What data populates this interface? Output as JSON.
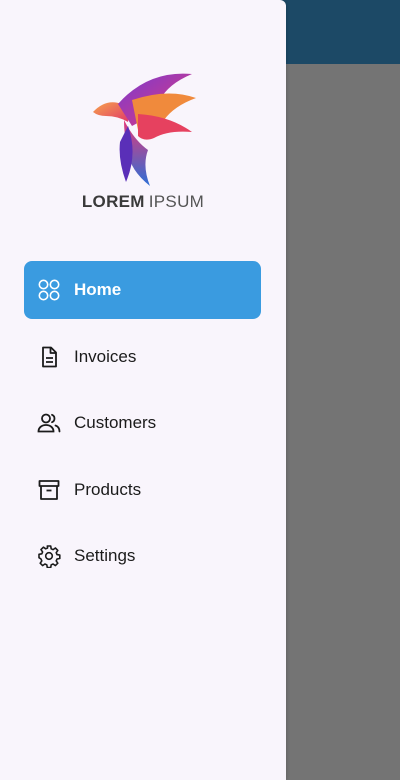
{
  "colors": {
    "topbar": "#1c4966",
    "drawer_bg": "#f9f5fc",
    "active_bg": "#3a9be0",
    "overlay": "#747474"
  },
  "logo": {
    "word1": "LOREM",
    "word2": "IPSUM"
  },
  "nav": {
    "items": [
      {
        "label": "Home",
        "icon": "grid-icon",
        "active": true
      },
      {
        "label": "Invoices",
        "icon": "document-icon",
        "active": false
      },
      {
        "label": "Customers",
        "icon": "users-icon",
        "active": false
      },
      {
        "label": "Products",
        "icon": "archive-box-icon",
        "active": false
      },
      {
        "label": "Settings",
        "icon": "gear-icon",
        "active": false
      }
    ]
  }
}
